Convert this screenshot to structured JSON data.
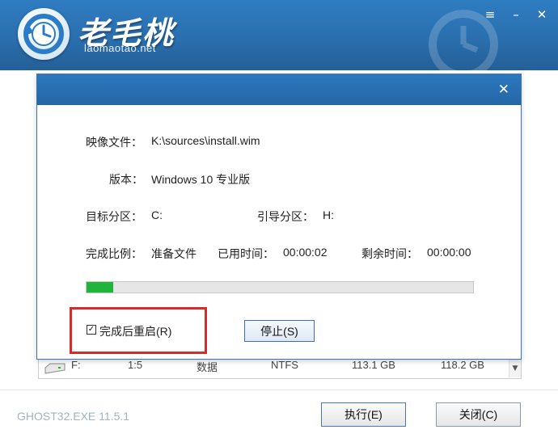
{
  "header": {
    "logo_title": "老毛桃",
    "logo_url": "laomaotao.net",
    "window_controls": [
      "≡",
      "–",
      "✕"
    ]
  },
  "dialog": {
    "close_glyph": "✕",
    "image_file_label": "映像文件：",
    "image_file_value": "K:\\sources\\install.wim",
    "version_label": "版本：",
    "version_value": "Windows 10 专业版",
    "target_label": "目标分区：",
    "target_value": "C:",
    "boot_label": "引导分区：",
    "boot_value": "H:",
    "ratio_label": "完成比例：",
    "ratio_value": "准备文件",
    "elapsed_label": "已用时间：",
    "elapsed_value": "00:00:02",
    "remaining_label": "剩余时间：",
    "remaining_value": "00:00:00",
    "progress_fraction": 0.07,
    "restart_checkbox_label": "完成后重启(R)",
    "restart_checked": true,
    "stop_button": "停止(S)"
  },
  "partition_row": {
    "drive": "F:",
    "index": "1:5",
    "type": "数据",
    "fs": "NTFS",
    "used": "113.1 GB",
    "total": "118.2 GB"
  },
  "footer": {
    "version": "GHOST32.EXE 11.5.1",
    "execute_button": "执行(E)",
    "close_button": "关闭(C)"
  },
  "colors": {
    "header_blue": "#2a6fae",
    "progress_green": "#1fb53a",
    "highlight_red": "#d62b2b"
  },
  "icons": [
    "restore-clock-icon",
    "menu-icon",
    "minimize-icon",
    "close-icon",
    "drive-icon",
    "scroll-down-icon"
  ]
}
